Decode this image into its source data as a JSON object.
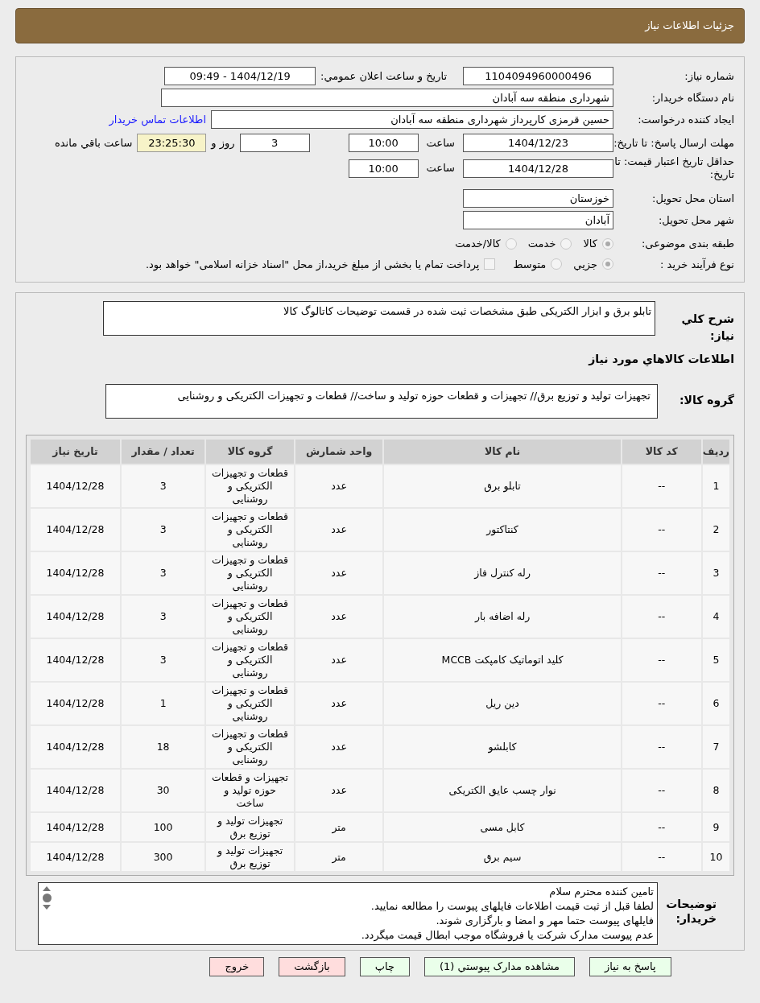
{
  "header": {
    "title": "جزئیات اطلاعات نیاز"
  },
  "form": {
    "need_number": {
      "label": "شماره نیاز:",
      "value": "1104094960000496"
    },
    "announce": {
      "label": "تاریخ و ساعت اعلان عمومي:",
      "value": "1404/12/19 - 09:49"
    },
    "buyer_org": {
      "label": "نام دستگاه خریدار:",
      "value": "شهرداری منطقه سه آبادان"
    },
    "creator": {
      "label": "ایجاد کننده درخواست:",
      "value": "حسین قرمزی کارپرداز شهرداری منطقه سه آبادان",
      "link": "اطلاعات تماس خریدار"
    },
    "deadline": {
      "label": "مهلت ارسال پاسخ: تا تاریخ:",
      "date": "1404/12/23",
      "time_label": "ساعت",
      "time": "10:00",
      "days": "3",
      "days_label": "روز و",
      "remaining": "23:25:30",
      "remaining_label": "ساعت باقي مانده"
    },
    "validity": {
      "label": "حداقل تاریخ اعتبار قیمت: تا تاریخ:",
      "date": "1404/12/28",
      "time_label": "ساعت",
      "time": "10:00"
    },
    "province": {
      "label": "استان محل تحویل:",
      "value": "خوزستان"
    },
    "city": {
      "label": "شهر محل تحویل:",
      "value": "آبادان"
    },
    "category": {
      "label": "طبقه بندی موضوعی:",
      "options": [
        {
          "label": "کالا",
          "selected": true
        },
        {
          "label": "خدمت",
          "selected": false
        },
        {
          "label": "کالا/خدمت",
          "selected": false
        }
      ]
    },
    "process": {
      "label": "نوع فرآیند خرید :",
      "options": [
        {
          "label": "جزيي",
          "selected": true
        },
        {
          "label": "متوسط",
          "selected": false
        }
      ],
      "treasury": {
        "checked": false,
        "label": "پرداخت تمام یا بخشی از مبلغ خرید،از محل \"اسناد خزانه اسلامی\" خواهد بود."
      }
    }
  },
  "summary": {
    "label": "شرح کلي نياز:",
    "value": "تابلو برق و ابزار الکتریکی طبق مشخصات ثبت شده در قسمت توضیحات کاتالوگ کالا"
  },
  "goods_title": "اطلاعات کالاهاي مورد نياز",
  "goods_group": {
    "label": "گروه کالا:",
    "value": "تجهیزات تولید و توزیع برق// تجهیزات و قطعات حوزه تولید و ساخت// قطعات و تجهیزات الکتریکی و روشنایی"
  },
  "table": {
    "columns": [
      "ردیف",
      "کد کالا",
      "نام کالا",
      "واحد شمارش",
      "گروه کالا",
      "تعداد / مقدار",
      "تاریخ نیاز"
    ],
    "rows": [
      [
        "1",
        "--",
        "تابلو برق",
        "عدد",
        "قطعات و تجهیزات الکتریکی و روشنایی",
        "3",
        "1404/12/28"
      ],
      [
        "2",
        "--",
        "کنتاکتور",
        "عدد",
        "قطعات و تجهیزات الکتریکی و روشنایی",
        "3",
        "1404/12/28"
      ],
      [
        "3",
        "--",
        "رله کنترل فاز",
        "عدد",
        "قطعات و تجهیزات الکتریکی و روشنایی",
        "3",
        "1404/12/28"
      ],
      [
        "4",
        "--",
        "رله اضافه بار",
        "عدد",
        "قطعات و تجهیزات الکتریکی و روشنایی",
        "3",
        "1404/12/28"
      ],
      [
        "5",
        "--",
        "کلید اتوماتیک کامپکت MCCB",
        "عدد",
        "قطعات و تجهیزات الکتریکی و روشنایی",
        "3",
        "1404/12/28"
      ],
      [
        "6",
        "--",
        "دین ریل",
        "عدد",
        "قطعات و تجهیزات الکتریکی و روشنایی",
        "1",
        "1404/12/28"
      ],
      [
        "7",
        "--",
        "کابلشو",
        "عدد",
        "قطعات و تجهیزات الکتریکی و روشنایی",
        "18",
        "1404/12/28"
      ],
      [
        "8",
        "--",
        "نوار چسب عایق الکتریکی",
        "عدد",
        "تجهیزات و قطعات حوزه تولید و ساخت",
        "30",
        "1404/12/28"
      ],
      [
        "9",
        "--",
        "کابل مسی",
        "متر",
        "تجهیزات تولید و توزیع برق",
        "100",
        "1404/12/28"
      ],
      [
        "10",
        "--",
        "سیم برق",
        "متر",
        "تجهیزات تولید و توزیع برق",
        "300",
        "1404/12/28"
      ]
    ]
  },
  "buyer_notes": {
    "label": "توضیحات خریدار:",
    "lines": [
      "تامین کننده محترم سلام",
      "لطفا قبل از ثبت قیمت اطلاعات فایلهای پیوست را مطالعه نمایید.",
      "فایلهای پیوست حتما مهر و امضا و بارگزاری شوند.",
      "عدم پیوست مدارک شرکت یا فروشگاه موجب ابطال قیمت میگردد."
    ]
  },
  "buttons": [
    {
      "label": "پاسخ به نیاز",
      "kind": "primary"
    },
    {
      "label": "مشاهده مدارک پیوستي (1)",
      "kind": "primary"
    },
    {
      "label": "چاپ",
      "kind": "primary"
    },
    {
      "label": "بازگشت",
      "kind": "danger"
    },
    {
      "label": "خروج",
      "kind": "danger"
    }
  ]
}
